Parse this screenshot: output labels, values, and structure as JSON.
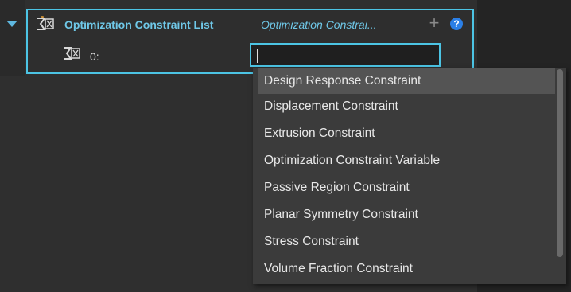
{
  "constraint_list": {
    "title": "Optimization Constraint List",
    "type_display": "Optimization Constrai...",
    "add_label": "+",
    "help_label": "?",
    "item": {
      "index_label": "0:",
      "value": ""
    }
  },
  "dropdown": {
    "highlighted_index": 0,
    "options": [
      "Design Response Constraint",
      "Displacement Constraint",
      "Extrusion Constraint",
      "Optimization Constraint Variable",
      "Passive Region Constraint",
      "Planar Symmetry Constraint",
      "Stress Constraint",
      "Volume Fraction Constraint"
    ]
  },
  "colors": {
    "accent": "#4cc4e4",
    "title_text": "#6fc8e8",
    "background": "#2f2f2f",
    "dropdown_bg": "#3b3b3b",
    "highlight_bg": "#545454",
    "help_blue": "#2b7fe6"
  },
  "icons": {
    "expand": "caret-down-icon",
    "list": "sigma-constraint-icon",
    "item": "sigma-constraint-icon",
    "add": "plus-icon",
    "help": "help-circle-icon"
  }
}
